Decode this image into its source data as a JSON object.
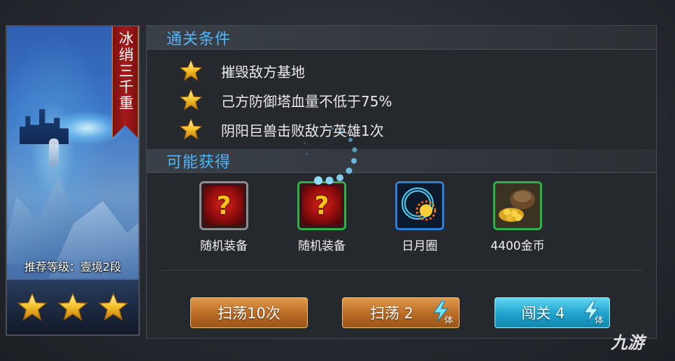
{
  "stage": {
    "name": "冰绡三千重",
    "recommended_level": "推荐等级：壹境2段",
    "stars_earned": 3,
    "stars_total": 3
  },
  "clear_conditions": {
    "title": "通关条件",
    "items": [
      {
        "text": "摧毁敌方基地",
        "achieved": true
      },
      {
        "text": "己方防御塔血量不低于75%",
        "achieved": true
      },
      {
        "text": "阴阳巨兽击败敌方英雄1次",
        "achieved": true
      }
    ]
  },
  "rewards": {
    "title": "可能获得",
    "items": [
      {
        "label": "随机装备",
        "icon": "mystery-equipment-icon",
        "rarity_color": "#8b8e92"
      },
      {
        "label": "随机装备",
        "icon": "mystery-equipment-icon",
        "rarity_color": "#2fb14a"
      },
      {
        "label": "日月圈",
        "icon": "sun-moon-ring-icon",
        "rarity_color": "#2f7fd6"
      },
      {
        "label": "4400金币",
        "icon": "gold-coins-icon",
        "rarity_color": "#2fb14a"
      }
    ]
  },
  "actions": {
    "sweep10_label": "扫荡10次",
    "sweep_label": "扫荡 2",
    "challenge_label": "闯关 4",
    "stamina_label": "体"
  },
  "watermark": "九游",
  "colors": {
    "section_title": "#4fb6ff",
    "button_orange": "#c87a30",
    "button_cyan": "#1ea2cc",
    "star_gold": "#f4c02a",
    "banner_red": "#a51a1a"
  }
}
